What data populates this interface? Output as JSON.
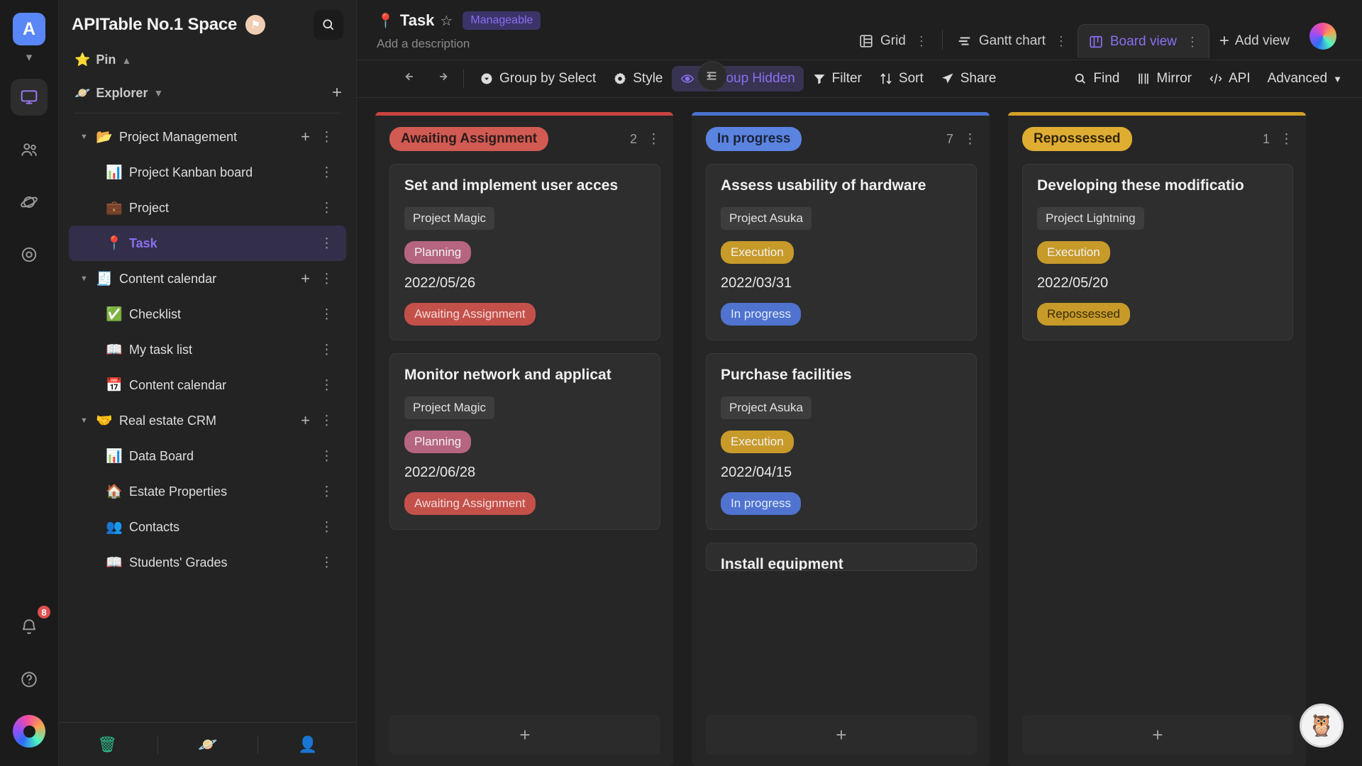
{
  "rail": {
    "workspace_initial": "A",
    "items": [
      {
        "name": "workspace-switcher-caret",
        "icon": "chevron-down-icon"
      },
      {
        "name": "rail-item-workbench",
        "icon": "monitor-icon",
        "active": true
      },
      {
        "name": "rail-item-members",
        "icon": "people-icon",
        "active": false
      },
      {
        "name": "rail-item-space",
        "icon": "planet-icon",
        "active": false
      },
      {
        "name": "rail-item-templates",
        "icon": "target-icon",
        "active": false
      }
    ],
    "notification_count": "8",
    "help_label": "?"
  },
  "sidebar": {
    "space_name": "APITable No.1 Space",
    "space_badge_icon": "flag-icon",
    "search_icon": "search-icon",
    "pin_label": "Pin",
    "pin_icon": "star-icon",
    "pin_caret": "chevron-up-icon",
    "explorer_label": "Explorer",
    "explorer_icon": "planet-icon",
    "explorer_caret": "chevron-down-icon",
    "add_icon": "plus-icon",
    "tree": [
      {
        "label": "Project Management",
        "emoji": "📂",
        "level": 0,
        "expanded": true,
        "selected": false,
        "has_add": true
      },
      {
        "label": "Project Kanban board",
        "emoji": "📊",
        "level": 1,
        "expanded": false,
        "selected": false,
        "has_add": false
      },
      {
        "label": "Project",
        "emoji": "💼",
        "level": 1,
        "expanded": false,
        "selected": false,
        "has_add": false
      },
      {
        "label": "Task",
        "emoji": "📍",
        "level": 1,
        "expanded": false,
        "selected": true,
        "has_add": false
      },
      {
        "label": "Content calendar",
        "emoji": "🧾",
        "level": 0,
        "expanded": true,
        "selected": false,
        "has_add": true
      },
      {
        "label": "Checklist",
        "emoji": "✅",
        "level": 1,
        "expanded": false,
        "selected": false,
        "has_add": false
      },
      {
        "label": "My task list",
        "emoji": "📖",
        "level": 1,
        "expanded": false,
        "selected": false,
        "has_add": false
      },
      {
        "label": "Content calendar",
        "emoji": "📅",
        "level": 1,
        "expanded": false,
        "selected": false,
        "has_add": false
      },
      {
        "label": "Real estate CRM",
        "emoji": "🤝",
        "level": 0,
        "expanded": true,
        "selected": false,
        "has_add": true
      },
      {
        "label": "Data Board",
        "emoji": "📊",
        "level": 1,
        "expanded": false,
        "selected": false,
        "has_add": false
      },
      {
        "label": "Estate Properties",
        "emoji": "🏠",
        "level": 1,
        "expanded": false,
        "selected": false,
        "has_add": false
      },
      {
        "label": "Contacts",
        "emoji": "👥",
        "level": 1,
        "expanded": false,
        "selected": false,
        "has_add": false
      },
      {
        "label": "Students' Grades",
        "emoji": "📖",
        "level": 1,
        "expanded": false,
        "selected": false,
        "has_add": false
      }
    ],
    "footer": [
      {
        "name": "trash-icon",
        "glyph": "🗑",
        "color": "#2fbd8c"
      },
      {
        "name": "space-icon",
        "glyph": "🪐",
        "color": "#3b82f6"
      },
      {
        "name": "invite-user-icon",
        "glyph": "👤",
        "color": "#9aa4b2"
      }
    ]
  },
  "node": {
    "pin_emoji": "📍",
    "title": "Task",
    "star_icon": "star-outline-icon",
    "role_badge": "Manageable",
    "description_placeholder": "Add a description"
  },
  "views": {
    "tabs": [
      {
        "label": "Grid",
        "icon": "grid-icon",
        "active": false
      },
      {
        "label": "Gantt chart",
        "icon": "gantt-icon",
        "active": false
      },
      {
        "label": "Board view",
        "icon": "board-icon",
        "active": true
      }
    ],
    "add_view_label": "Add view",
    "add_view_icon": "plus-icon",
    "avatar_name": "user-avatar"
  },
  "toolbar": {
    "collapse_icon": "collapse-sidebar-icon",
    "undo_icon": "undo-icon",
    "redo_icon": "redo-icon",
    "items": [
      {
        "label": "Group by Select",
        "icon": "group-icon",
        "highlight": false
      },
      {
        "label": "Style",
        "icon": "gear-icon",
        "highlight": false
      },
      {
        "label": "1 Group Hidden",
        "icon": "eye-icon",
        "highlight": true
      },
      {
        "label": "Filter",
        "icon": "filter-icon",
        "highlight": false
      },
      {
        "label": "Sort",
        "icon": "sort-icon",
        "highlight": false
      },
      {
        "label": "Share",
        "icon": "share-icon",
        "highlight": false
      }
    ],
    "right_items": [
      {
        "label": "Find",
        "icon": "search-icon"
      },
      {
        "label": "Mirror",
        "icon": "mirror-icon"
      },
      {
        "label": "API",
        "icon": "api-icon"
      },
      {
        "label": "Advanced",
        "icon": "chevron-down-icon"
      }
    ]
  },
  "board": {
    "add_card_icon": "plus-icon",
    "columns": [
      {
        "name": "Awaiting Assignment",
        "accent_color": "#c9443f",
        "chip_bg": "#d15a52",
        "chip_text_color": "#2a1c1b",
        "count": "2",
        "menu_icon": "more-vertical-icon",
        "cards": [
          {
            "title": "Set and implement user acces",
            "project": "Project Magic",
            "phase": "Planning",
            "phase_bg": "#b5657f",
            "date": "2022/05/26",
            "status": "Awaiting Assignment",
            "status_bg": "#c4504a",
            "status_text_color": "#f4d9d7"
          },
          {
            "title": "Monitor network and applicat",
            "project": "Project Magic",
            "phase": "Planning",
            "phase_bg": "#b5657f",
            "date": "2022/06/28",
            "status": "Awaiting Assignment",
            "status_bg": "#c4504a",
            "status_text_color": "#f4d9d7"
          }
        ]
      },
      {
        "name": "In progress",
        "accent_color": "#4a72d0",
        "chip_bg": "#5b83e0",
        "chip_text_color": "#1a2339",
        "count": "7",
        "menu_icon": "more-vertical-icon",
        "cards": [
          {
            "title": "Assess usability of hardware",
            "project": "Project Asuka",
            "phase": "Execution",
            "phase_bg": "#c79a2a",
            "date": "2022/03/31",
            "status": "In progress",
            "status_bg": "#4f73cf",
            "status_text_color": "#e2eaff"
          },
          {
            "title": "Purchase facilities",
            "project": "Project Asuka",
            "phase": "Execution",
            "phase_bg": "#c79a2a",
            "date": "2022/04/15",
            "status": "In progress",
            "status_bg": "#4f73cf",
            "status_text_color": "#e2eaff"
          },
          {
            "title": "Install equipment",
            "project": "",
            "phase": "",
            "phase_bg": "#c79a2a",
            "date": "",
            "status": "",
            "status_bg": "#4f73cf",
            "status_text_color": "#e2eaff",
            "clipped": true
          }
        ]
      },
      {
        "name": "Repossessed",
        "accent_color": "#d3a028",
        "chip_bg": "#e0ad33",
        "chip_text_color": "#302507",
        "count": "1",
        "menu_icon": "more-vertical-icon",
        "cards": [
          {
            "title": "Developing these modificatio",
            "project": "Project Lightning",
            "phase": "Execution",
            "phase_bg": "#c79a2a",
            "date": "2022/05/20",
            "status": "Repossessed",
            "status_bg": "#c79a2a",
            "status_text_color": "#3a2d08"
          }
        ]
      }
    ]
  },
  "chat_widget": {
    "name": "chat-assistant-button",
    "glyph": "🦉"
  }
}
